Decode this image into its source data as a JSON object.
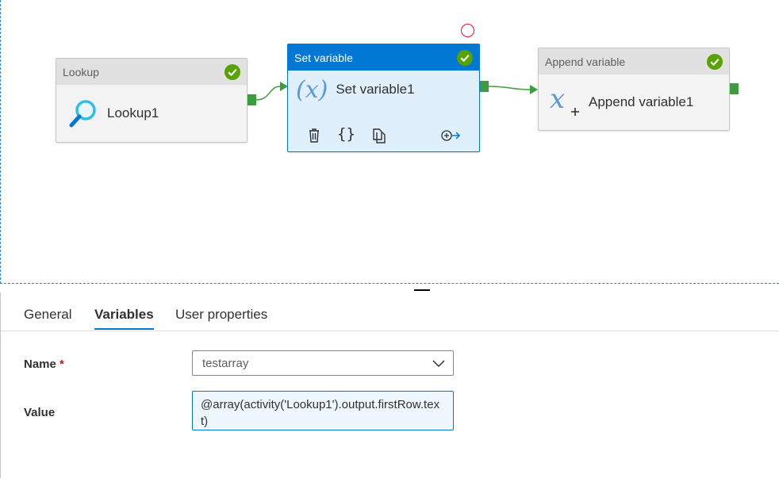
{
  "pipeline": {
    "activities": [
      {
        "type_label": "Lookup",
        "name": "Lookup1",
        "status": "succeeded",
        "icon": "lookup-magnifier-icon"
      },
      {
        "type_label": "Set variable",
        "name": "Set variable1",
        "status": "succeeded",
        "icon": "set-variable-icon",
        "icon_text": "(x)",
        "selected": true
      },
      {
        "type_label": "Append variable",
        "name": "Append variable1",
        "status": "succeeded",
        "icon": "append-variable-icon"
      }
    ],
    "toolbar_icons": [
      "delete-icon",
      "code-braces-icon",
      "copy-icon",
      "add-output-icon"
    ],
    "braces_glyph": "{}"
  },
  "properties": {
    "tabs": [
      {
        "label": "General",
        "active": false
      },
      {
        "label": "Variables",
        "active": true
      },
      {
        "label": "User properties",
        "active": false
      }
    ],
    "name_label": "Name",
    "required_marker": "*",
    "name_value": "testarray",
    "value_label": "Value",
    "value_text": "@array(activity('Lookup1').output.firstRow.text)"
  },
  "colors": {
    "accent": "#0078d4",
    "success": "#57a300",
    "port": "#3d9c3e",
    "canvas_border": "#2b88d8"
  }
}
